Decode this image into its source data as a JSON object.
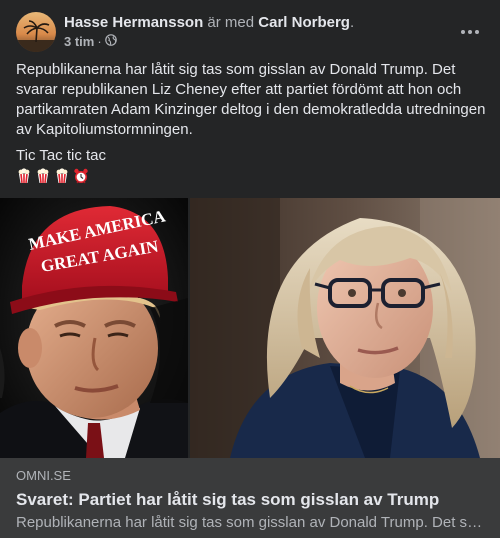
{
  "post": {
    "author": "Hasse Hermansson",
    "with_text": "är med",
    "tagged": "Carl Norberg",
    "tagged_suffix": ".",
    "time": "3 tim",
    "separator": "·",
    "privacy_icon": "globe-icon",
    "more_icon": "more-options-icon",
    "text": "Republikanerna har låtit sig tas som gisslan av Donald Trump. Det svarar republikanen Liz Cheney efter att partiet fördömt att hon och partikamraten Adam Kinzinger deltog i den demokratledda utredningen av Kapitoliumstormningen.",
    "text2": "Tic Tac tic tac",
    "emojis": [
      "popcorn-icon",
      "popcorn-icon",
      "popcorn-icon",
      "alarm-clock-icon"
    ]
  },
  "media": {
    "left_image": "man-in-red-cap-photo",
    "cap_line1": "MAKE AMERICA",
    "cap_line2": "GREAT AGAIN",
    "right_image": "woman-with-glasses-photo"
  },
  "link": {
    "domain": "OMNI.SE",
    "headline": "Svaret: Partiet har låtit sig tas som gisslan av Trump",
    "description": "Republikanerna har låtit sig tas som gisslan av Donald Trump. Det svarar republikanen Liz Cheney efter att partiet fördömt att hon och partikamraten Adam Kinzinger deltog"
  },
  "colors": {
    "background": "#242526",
    "card": "#3a3b3c",
    "primary_text": "#e4e6eb",
    "secondary_text": "#b0b3b8",
    "cap_red": "#c8102e"
  }
}
